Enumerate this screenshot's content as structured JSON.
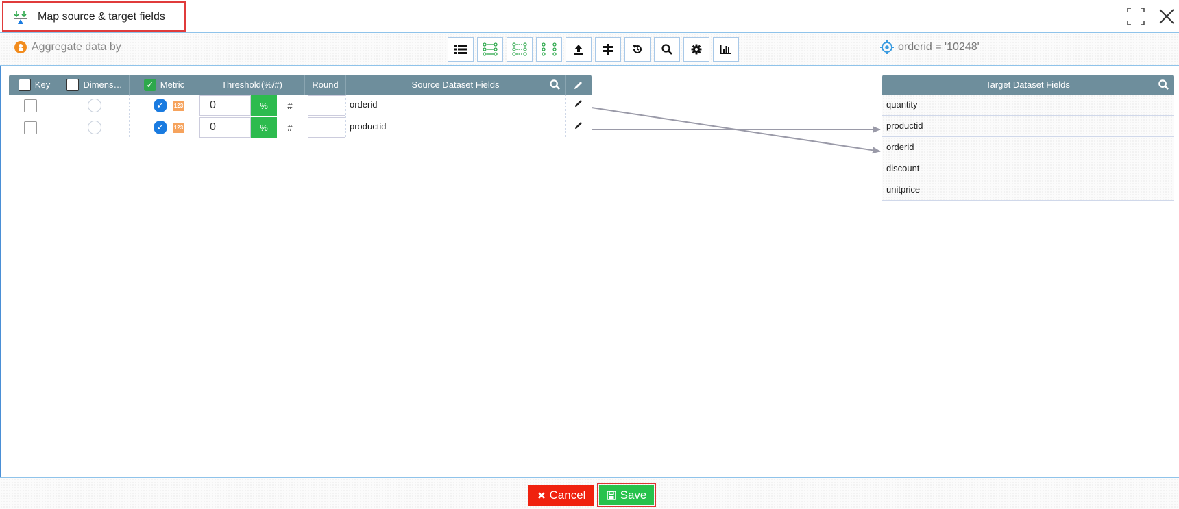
{
  "window": {
    "title": "Map source & target fields"
  },
  "toolbar": {
    "aggregate_label": "Aggregate data by",
    "filter_text": "orderid = '10248'",
    "buttons": [
      "list-icon",
      "map-list-icon",
      "map-auto-icon",
      "map-clear-icon",
      "upload-icon",
      "split-icon",
      "reset-icon",
      "search-icon",
      "settings-icon",
      "chart-icon"
    ]
  },
  "source": {
    "columns": {
      "key": "Key",
      "dimension": "Dimens…",
      "metric": "Metric",
      "threshold": "Threshold(%/#)",
      "round": "Round",
      "fields": "Source Dataset Fields"
    },
    "rows": [
      {
        "field": "orderid",
        "threshold": "0",
        "pct_label": "%",
        "hash_label": "#",
        "num_badge": "123"
      },
      {
        "field": "productid",
        "threshold": "0",
        "pct_label": "%",
        "hash_label": "#",
        "num_badge": "123"
      }
    ]
  },
  "target": {
    "header": "Target Dataset Fields",
    "fields": [
      "quantity",
      "productid",
      "orderid",
      "discount",
      "unitprice"
    ]
  },
  "mappings": [
    {
      "source": "orderid",
      "target": "orderid"
    },
    {
      "source": "productid",
      "target": "productid"
    }
  ],
  "footer": {
    "cancel_label": "Cancel",
    "save_label": "Save"
  },
  "colors": {
    "accent_blue": "#1a7be0",
    "header_gray": "#6e8e9c",
    "green": "#2dbb4e",
    "red": "#f0220f"
  }
}
